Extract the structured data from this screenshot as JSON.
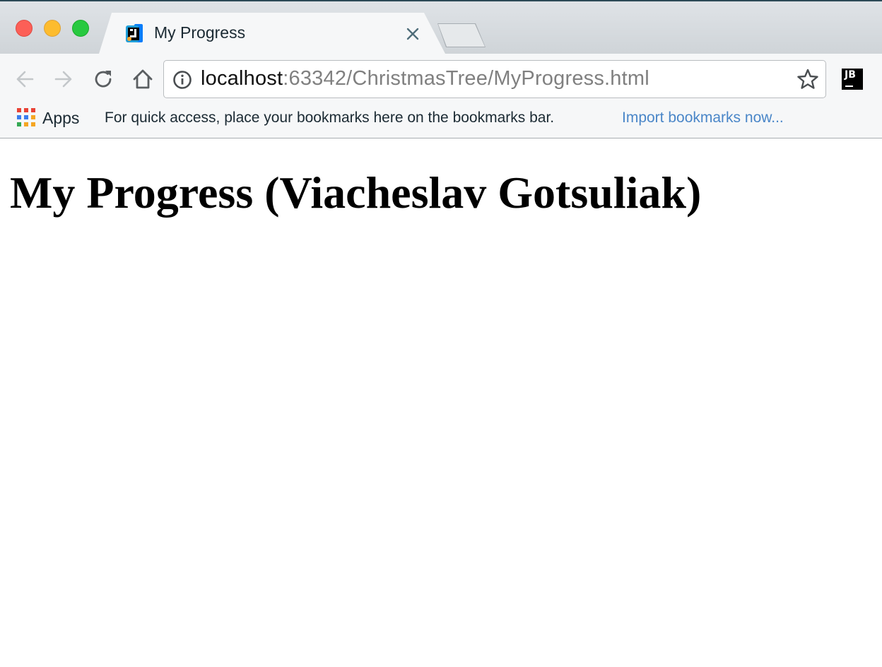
{
  "window": {
    "controls": [
      "close",
      "minimize",
      "zoom"
    ],
    "colors": {
      "close": "#fc5f57",
      "minimize": "#fdbc2e",
      "zoom": "#28c940"
    }
  },
  "tab": {
    "title": "My Progress",
    "icon": "jetbrains-ij-icon"
  },
  "toolbar": {
    "back_icon": "arrow-left-icon",
    "forward_icon": "arrow-right-icon",
    "reload_icon": "reload-icon",
    "home_icon": "home-icon"
  },
  "omnibox": {
    "host": "localhost",
    "path": ":63342/ChristmasTree/MyProgress.html"
  },
  "extensions": {
    "jb_label": "JB"
  },
  "bookmarks_bar": {
    "apps_label": "Apps",
    "hint": "For quick access, place your bookmarks here on the bookmarks bar.",
    "import_link": "Import bookmarks now...",
    "link_color": "#4a86c8"
  },
  "page": {
    "heading": "My Progress (Viacheslav Gotsuliak)"
  }
}
